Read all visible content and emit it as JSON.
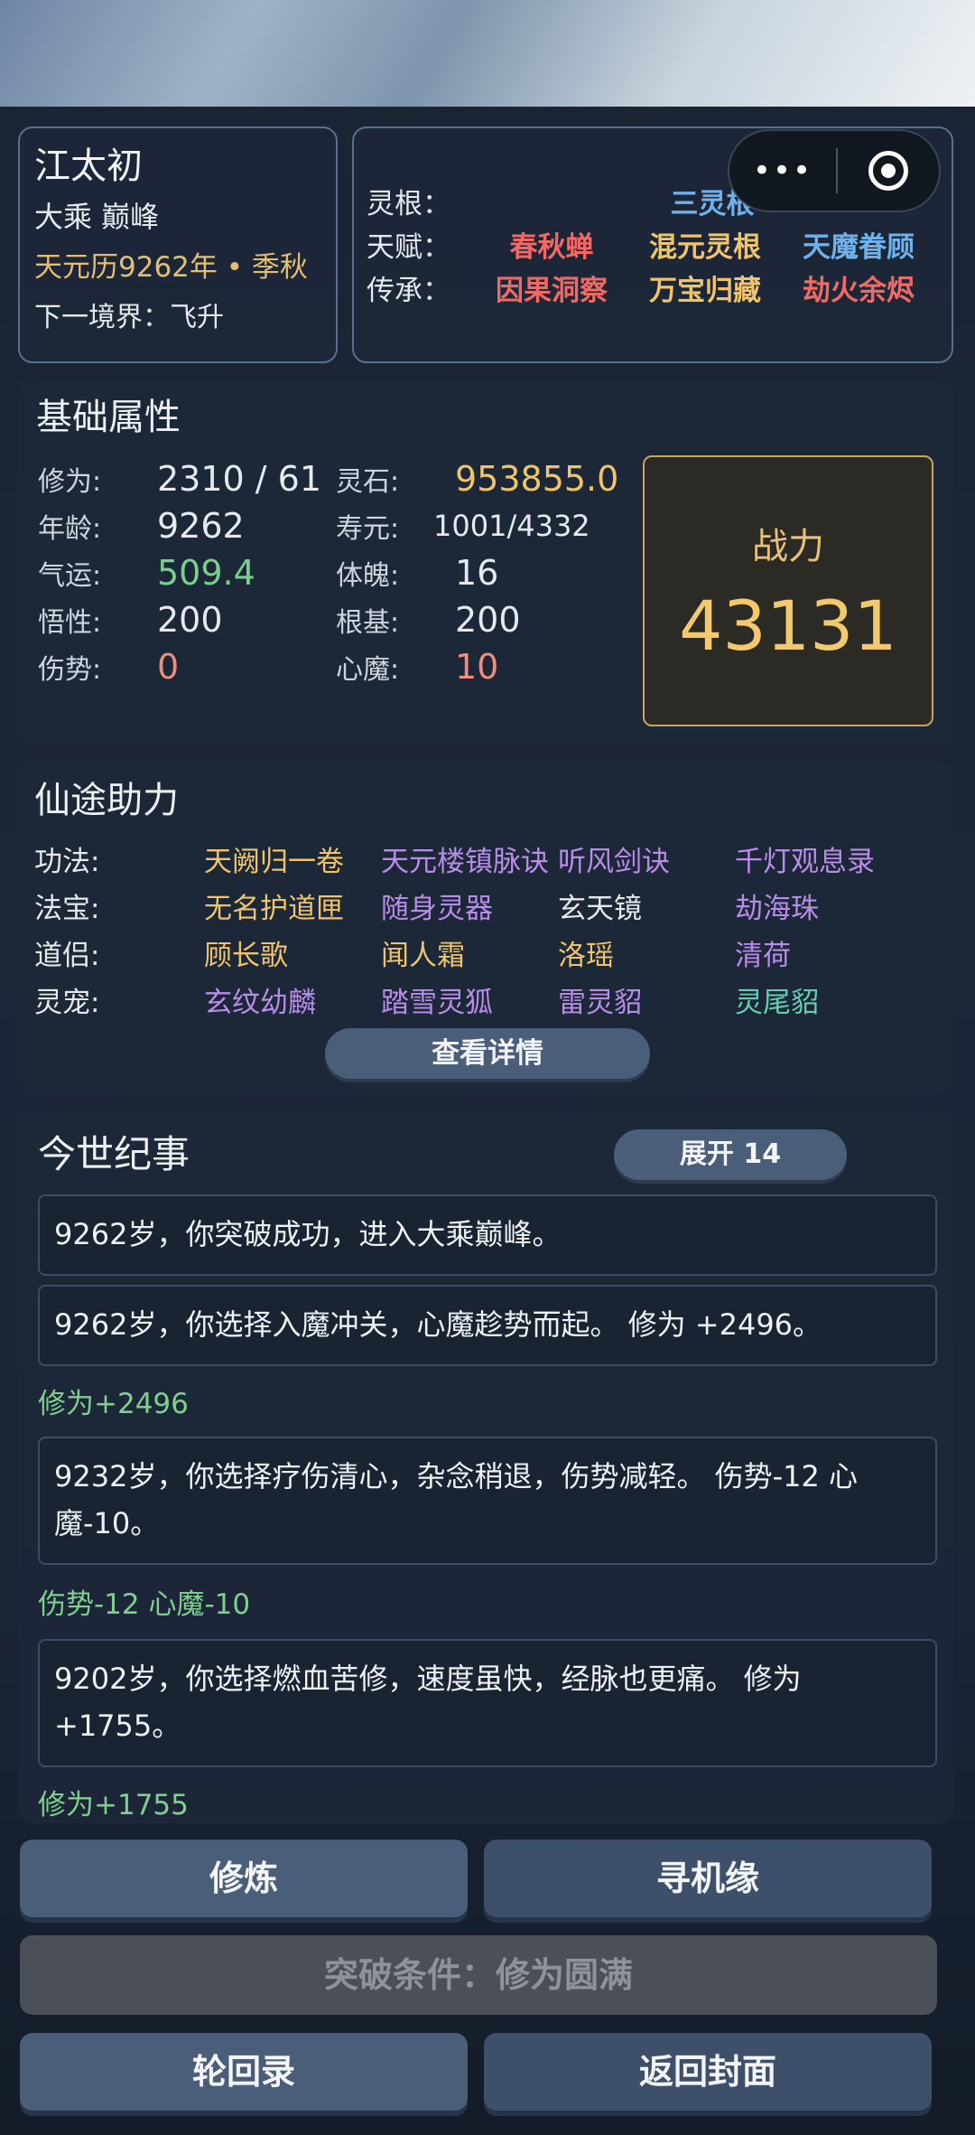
{
  "header": {
    "name": "江太初",
    "realm": "大乘 巅峰",
    "date": "天元历9262年 • 季秋",
    "next_realm": "下一境界：飞升"
  },
  "traits": {
    "root_label": "灵根：",
    "root_value": "三灵根",
    "talent_label": "天赋：",
    "talents": [
      "春秋蝉",
      "混元灵根",
      "天魔眷顾"
    ],
    "heritage_label": "传承：",
    "heritages": [
      "因果洞察",
      "万宝归藏",
      "劫火余烬"
    ]
  },
  "capsule": {
    "more_icon": "more-dots-icon",
    "close_icon": "record-circle-icon"
  },
  "stats": {
    "title": "基础属性",
    "cultivation_label": "修为:",
    "cultivation_value": "2310 / 61",
    "spirit_stone_label": "灵石:",
    "spirit_stone_value": "953855.0",
    "age_label": "年龄:",
    "age_value": "9262",
    "lifespan_label": "寿元:",
    "lifespan_value": "1001/4332",
    "luck_label": "气运:",
    "luck_value": "509.4",
    "physique_label": "体魄:",
    "physique_value": "16",
    "insight_label": "悟性:",
    "insight_value": "200",
    "foundation_label": "根基:",
    "foundation_value": "200",
    "injury_label": "伤势:",
    "injury_value": "0",
    "demon_label": "心魔:",
    "demon_value": "10",
    "power_label": "战力",
    "power_value": "43131"
  },
  "assist": {
    "title": "仙途助力",
    "rows": [
      {
        "label": "功法:",
        "items": [
          "天阙归一卷",
          "天元楼镇脉诀",
          "听风剑诀",
          "千灯观息录"
        ]
      },
      {
        "label": "法宝:",
        "items": [
          "无名护道匣",
          "随身灵器",
          "玄天镜",
          "劫海珠"
        ]
      },
      {
        "label": "道侣:",
        "items": [
          "顾长歌",
          "闻人霜",
          "洛瑶",
          "清荷"
        ]
      },
      {
        "label": "灵宠:",
        "items": [
          "玄纹幼麟",
          "踏雪灵狐",
          "雷灵貂",
          "灵尾貂"
        ]
      }
    ],
    "detail_button": "查看详情"
  },
  "chronicle": {
    "title": "今世纪事",
    "expand_button": "展开 14",
    "entries": [
      "9262岁，你突破成功，进入大乘巅峰。",
      "9262岁，你选择入魔冲关，心魔趁势而起。 修为 +2496。",
      "9232岁，你选择疗伤清心，杂念稍退，伤势减轻。 伤势-12 心魔-10。",
      "9202岁，你选择燃血苦修，速度虽快，经脉也更痛。 修为 +1755。"
    ],
    "gains": [
      "修为+2496",
      "伤势-12  心魔-10",
      "修为+1755"
    ]
  },
  "actions": {
    "cultivate": "修炼",
    "seek": "寻机缘",
    "breakthrough": "突破条件：修为圆满",
    "reincarnation": "轮回录",
    "back": "返回封面"
  }
}
